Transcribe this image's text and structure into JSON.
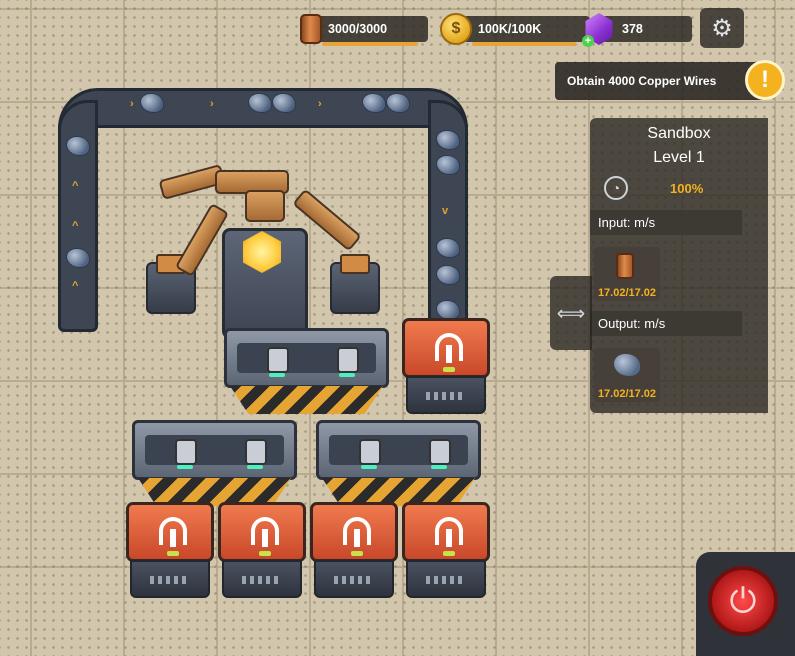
{
  "resources": {
    "copper": {
      "label": "3000/3000",
      "fill": 1.0,
      "icon": "copper-wire-icon"
    },
    "coins": {
      "label": "100K/100K",
      "fill": 1.0,
      "icon": "coin-icon"
    },
    "gems": {
      "label": "378",
      "icon": "purple-gem-icon"
    }
  },
  "quest": {
    "text": "Obtain 4000 Copper Wires",
    "button": "!"
  },
  "panel": {
    "title_line1": "Sandbox",
    "title_line2": "Level 1",
    "efficiency": "100%",
    "input_label": "Input: m/s",
    "input_value": "17.02/17.02",
    "output_label": "Output: m/s",
    "output_value": "17.02/17.02"
  },
  "icons": {
    "settings": "⚙",
    "collapse": "⟺",
    "power": "⏻"
  }
}
